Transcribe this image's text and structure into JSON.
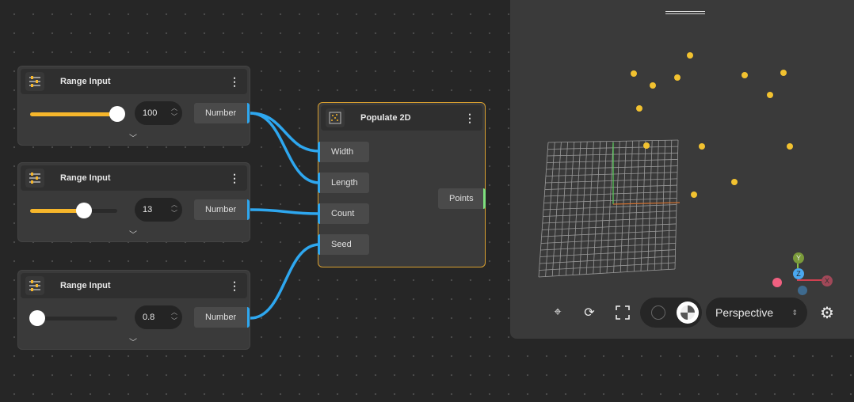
{
  "nodes": [
    {
      "title": "Range Input",
      "value": "100",
      "output": "Number",
      "fill": 1.0
    },
    {
      "title": "Range Input",
      "value": "13",
      "output": "Number",
      "fill": 0.62
    },
    {
      "title": "Range Input",
      "value": "0.8",
      "output": "Number",
      "fill": 0.08
    }
  ],
  "populate": {
    "title": "Populate 2D",
    "inputs": [
      "Width",
      "Length",
      "Count",
      "Seed"
    ],
    "output": "Points"
  },
  "viewport": {
    "camera_mode": "Perspective",
    "axes": {
      "x": "X",
      "y": "Y",
      "z": "Z"
    }
  },
  "colors": {
    "accent": "#f6b62b",
    "wire": "#2ea7ef",
    "points_port": "#7ee07e",
    "selected_border": "#d9a030"
  }
}
